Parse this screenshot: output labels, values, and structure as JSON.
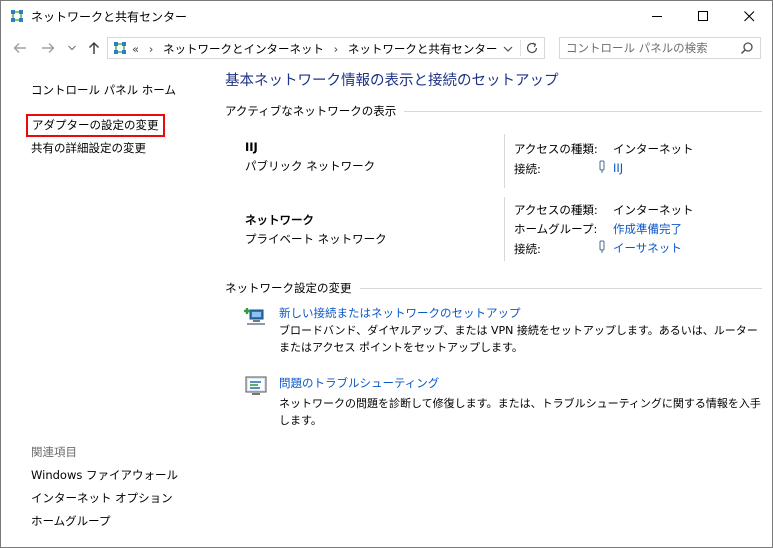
{
  "window": {
    "title": "ネットワークと共有センター"
  },
  "address": {
    "overflow": "«",
    "crumbs": [
      "ネットワークとインターネット",
      "ネットワークと共有センター"
    ],
    "separator": "›"
  },
  "search": {
    "placeholder": "コントロール パネルの検索"
  },
  "sidebar": {
    "home": "コントロール パネル ホーム",
    "adapter": "アダプターの設定の変更",
    "advanced": "共有の詳細設定の変更",
    "related_title": "関連項目",
    "related": [
      "Windows ファイアウォール",
      "インターネット オプション",
      "ホームグループ"
    ]
  },
  "main": {
    "title": "基本ネットワーク情報の表示と接続のセットアップ",
    "active_header": "アクティブなネットワークの表示",
    "networks": [
      {
        "name": "IIJ",
        "type": "パブリック ネットワーク",
        "access_label": "アクセスの種類:",
        "access_value": "インターネット",
        "conn_label": "接続:",
        "conn_value": "IIJ"
      },
      {
        "name": "ネットワーク",
        "type": "プライベート ネットワーク",
        "access_label": "アクセスの種類:",
        "access_value": "インターネット",
        "homegroup_label": "ホームグループ:",
        "homegroup_value": "作成準備完了",
        "conn_label": "接続:",
        "conn_value": "イーサネット"
      }
    ],
    "change_header": "ネットワーク設定の変更",
    "tasks": [
      {
        "link": "新しい接続またはネットワークのセットアップ",
        "desc": "ブロードバンド、ダイヤルアップ、または VPN 接続をセットアップします。あるいは、ルーターまたはアクセス ポイントをセットアップします。",
        "icon": "new-connection-icon"
      },
      {
        "link": "問題のトラブルシューティング",
        "desc": "ネットワークの問題を診断して修復します。または、トラブルシューティングに関する情報を入手します。",
        "icon": "troubleshoot-icon"
      }
    ]
  },
  "colors": {
    "title_blue": "#1e3287",
    "link_blue": "#0a58c7",
    "highlight_red": "#ea0a0a"
  }
}
